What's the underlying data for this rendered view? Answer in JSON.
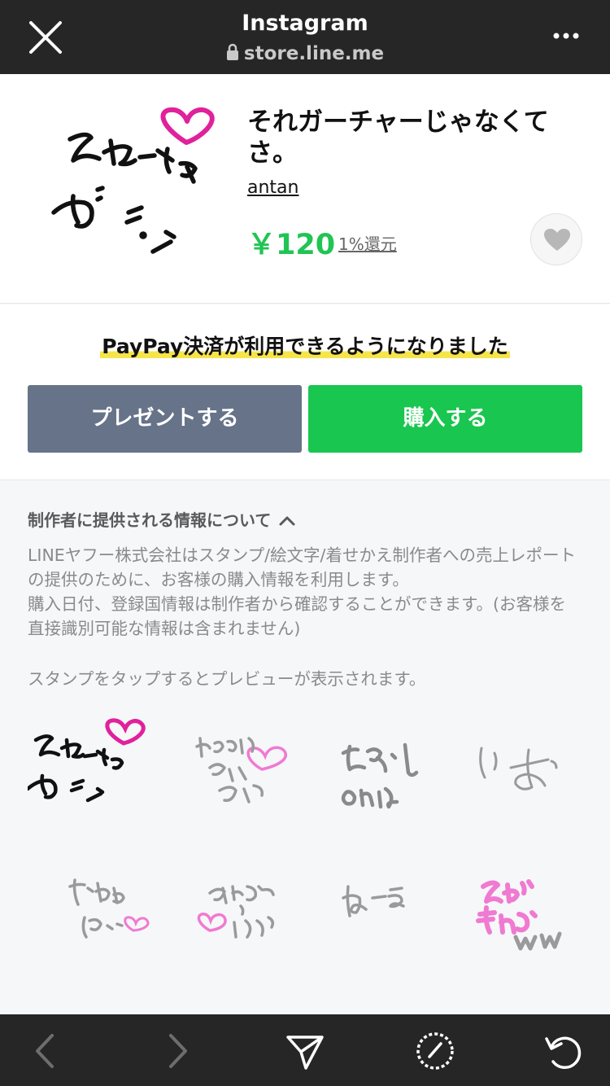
{
  "browser": {
    "title": "Instagram",
    "url": "store.line.me"
  },
  "product": {
    "name": "それガーチャーじゃなくてさ。",
    "author": "antan",
    "price": "￥120",
    "reward": "1%還元"
  },
  "purchase": {
    "paypay_notice": "PayPay決済が利用できるようになりました",
    "present_label": "プレゼントする",
    "buy_label": "購入する"
  },
  "info": {
    "heading": "制作者に提供される情報について",
    "desc_line1": "LINEヤフー株式会社はスタンプ/絵文字/着せかえ制作者への売上レポートの提供のために、お客様の購入情報を利用します。",
    "desc_line2": "購入日付、登録国情報は制作者から確認することができます。(お客様を直接識別可能な情報は含まれません)",
    "tap_hint": "スタンプをタップするとプレビューが表示されます。"
  },
  "stickers": [
    {
      "text": "それガーチャー",
      "color": "#111111",
      "accent": "#e0219c"
    },
    {
      "text": "ほんまゴメンやで",
      "color": "#9a9a9a",
      "accent": "#f07ad2"
    },
    {
      "text": "ちょっとしのんな",
      "color": "#8a8a8a",
      "accent": ""
    },
    {
      "text": "いお",
      "color": "#9a9a9a",
      "accent": ""
    },
    {
      "text": "だまれ ぼー",
      "color": "#9a9a9a",
      "accent": "#f07ad2"
    },
    {
      "text": "あんじょう いぼー",
      "color": "#9a9a9a",
      "accent": "#f07ad2"
    },
    {
      "text": "ね〜え",
      "color": "#9a9a9a",
      "accent": ""
    },
    {
      "text": "そんなもんかww",
      "color": "#f07ad2",
      "accent": "#9a9a9a"
    }
  ],
  "colors": {
    "bar_bg": "#262626",
    "buy_green": "#19c64f",
    "present_gray": "#677389",
    "price_green": "#20c554",
    "highlight_yellow": "#f5e54a"
  }
}
